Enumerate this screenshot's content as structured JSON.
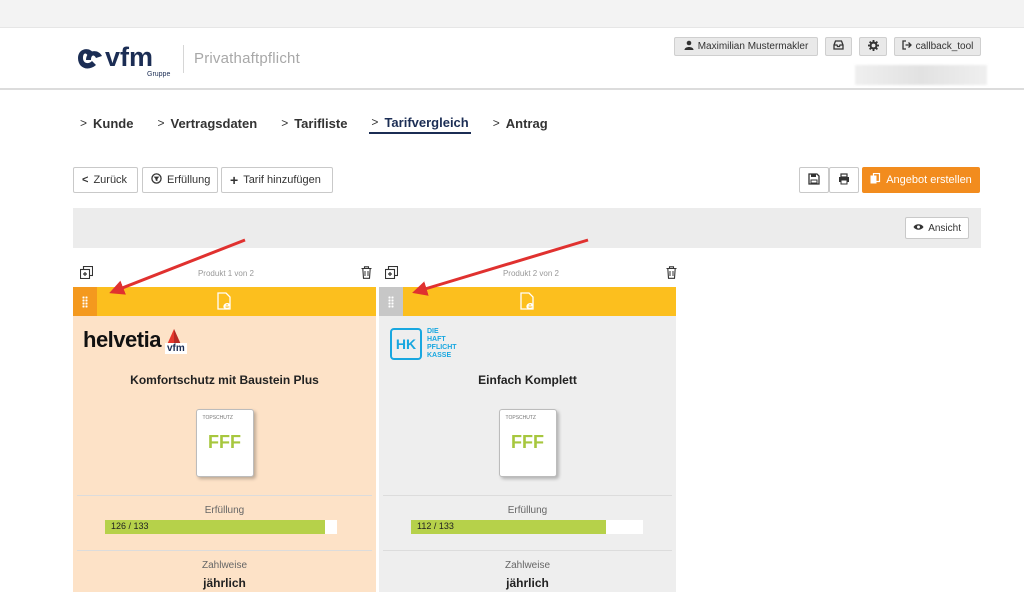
{
  "header": {
    "logo_text": "vfm",
    "logo_sub": "Gruppe",
    "title": "Privathaftpflicht",
    "user_label": "Maximilian Mustermakler",
    "logout_label": "callback_tool"
  },
  "nav": {
    "items": [
      {
        "label": "Kunde"
      },
      {
        "label": "Vertragsdaten"
      },
      {
        "label": "Tarifliste"
      },
      {
        "label": "Tarifvergleich",
        "active": true
      },
      {
        "label": "Antrag"
      }
    ]
  },
  "toolbar": {
    "back_label": "Zurück",
    "fulfillment_label": "Erfüllung",
    "add_tariff_label": "Tarif hinzufügen",
    "offer_label": "Angebot erstellen"
  },
  "panel": {
    "view_label": "Ansicht"
  },
  "products": [
    {
      "header_label": "Produkt 1 von 2",
      "insurer": "helvetia",
      "badge": "vfm",
      "name": "Komfortschutz mit Baustein Plus",
      "seal_top": "TOPSCHUTZ",
      "seal_rating": "FFF",
      "fulfillment_label": "Erfüllung",
      "fulfillment_text": "126 / 133",
      "fulfillment_value": 126,
      "fulfillment_max": 133,
      "payment_label": "Zahlweise",
      "payment_value": "jährlich"
    },
    {
      "header_label": "Produkt 2 von 2",
      "insurer_line1": "DIE",
      "insurer_line2": "HAFT",
      "insurer_line3": "PFLICHT",
      "insurer_line4": "KASSE",
      "insurer_mark": "HK",
      "name": "Einfach Komplett",
      "seal_top": "TOPSCHUTZ",
      "seal_rating": "FFF",
      "fulfillment_label": "Erfüllung",
      "fulfillment_text": "112 / 133",
      "fulfillment_value": 112,
      "fulfillment_max": 133,
      "payment_label": "Zahlweise",
      "payment_value": "jährlich"
    }
  ],
  "colors": {
    "accent_orange": "#f28c1e",
    "bar_yellow": "#fcbf1e",
    "progress_green": "#b6d14a",
    "nav_active": "#1b2d54",
    "annotation_red": "#e0312f"
  }
}
